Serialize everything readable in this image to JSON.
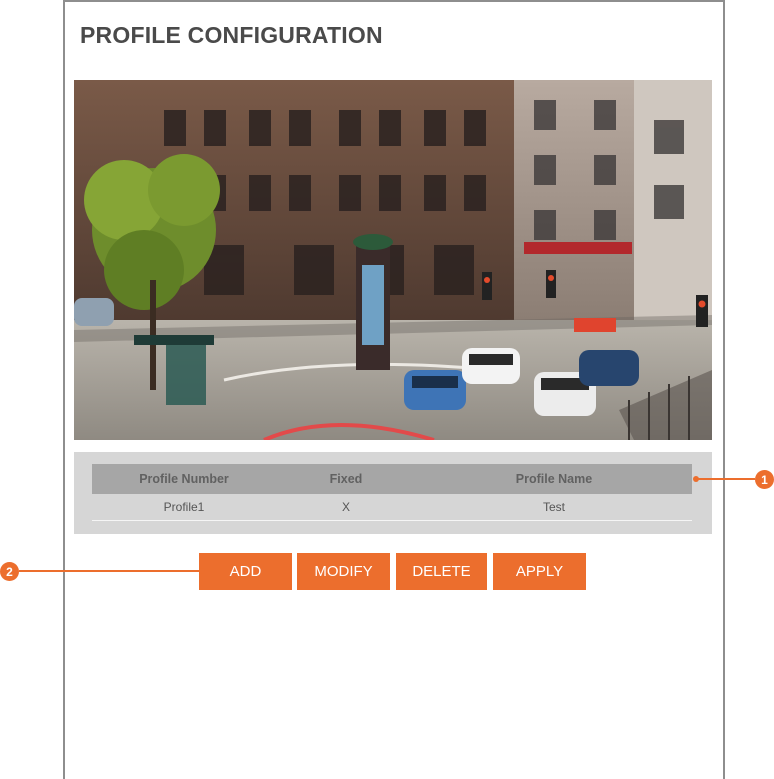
{
  "page": {
    "title": "PROFILE CONFIGURATION"
  },
  "preview": {
    "description_icon": "camera-live-view"
  },
  "table": {
    "headers": [
      "Profile Number",
      "Fixed",
      "Profile Name"
    ],
    "rows": [
      {
        "number": "Profile1",
        "fixed": "X",
        "name": "Test"
      }
    ]
  },
  "buttons": {
    "add": "ADD",
    "modify": "MODIFY",
    "delete": "DELETE",
    "apply": "APPLY"
  },
  "callouts": {
    "one": "1",
    "two": "2"
  },
  "colors": {
    "accent": "#ec6e2d",
    "table_header": "#a6a6a6",
    "table_bg": "#d6d6d6"
  }
}
